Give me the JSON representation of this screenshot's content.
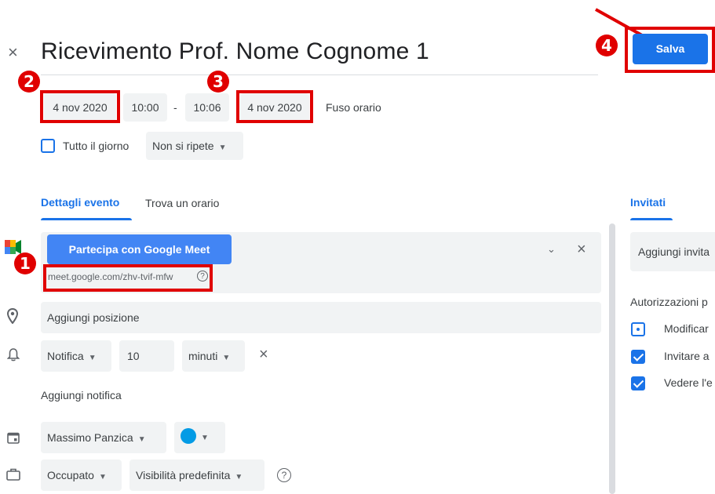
{
  "header": {
    "close_icon": "×",
    "title": "Ricevimento Prof. Nome Cognome 1",
    "save_label": "Salva"
  },
  "datetime": {
    "start_date": "4 nov 2020",
    "start_time": "10:00",
    "separator": "-",
    "end_time": "10:06",
    "end_date": "4 nov 2020",
    "timezone_label": "Fuso orario",
    "all_day_label": "Tutto il giorno",
    "all_day_checked": false,
    "repeat_value": "Non si ripete"
  },
  "tabs": [
    {
      "label": "Dettagli evento",
      "active": true
    },
    {
      "label": "Trova un orario",
      "active": false
    }
  ],
  "meet": {
    "join_label": "Partecipa con Google Meet",
    "link": "meet.google.com/zhv-tvif-mfw",
    "help_icon": "?"
  },
  "location": {
    "placeholder": "Aggiungi posizione"
  },
  "notification": {
    "type": "Notifica",
    "amount": "10",
    "unit": "minuti",
    "add_label": "Aggiungi notifica"
  },
  "calendar": {
    "owner": "Massimo Panzica",
    "color": "#039be5"
  },
  "status": {
    "busy": "Occupato",
    "visibility": "Visibilità predefinita"
  },
  "guests": {
    "tab_label": "Invitati",
    "add_placeholder": "Aggiungi invita",
    "permissions_title": "Autorizzazioni p",
    "permissions": [
      {
        "label": "Modificar",
        "checked": false
      },
      {
        "label": "Invitare a",
        "checked": true
      },
      {
        "label": "Vedere l'e",
        "checked": true
      }
    ]
  },
  "annotations": {
    "badge_1": "1",
    "badge_2": "2",
    "badge_3": "3",
    "badge_4": "4",
    "color": "#e00000"
  },
  "colors": {
    "accent": "#1a73e8",
    "meet_button": "#4285f4",
    "chip_bg": "#f1f3f4"
  }
}
